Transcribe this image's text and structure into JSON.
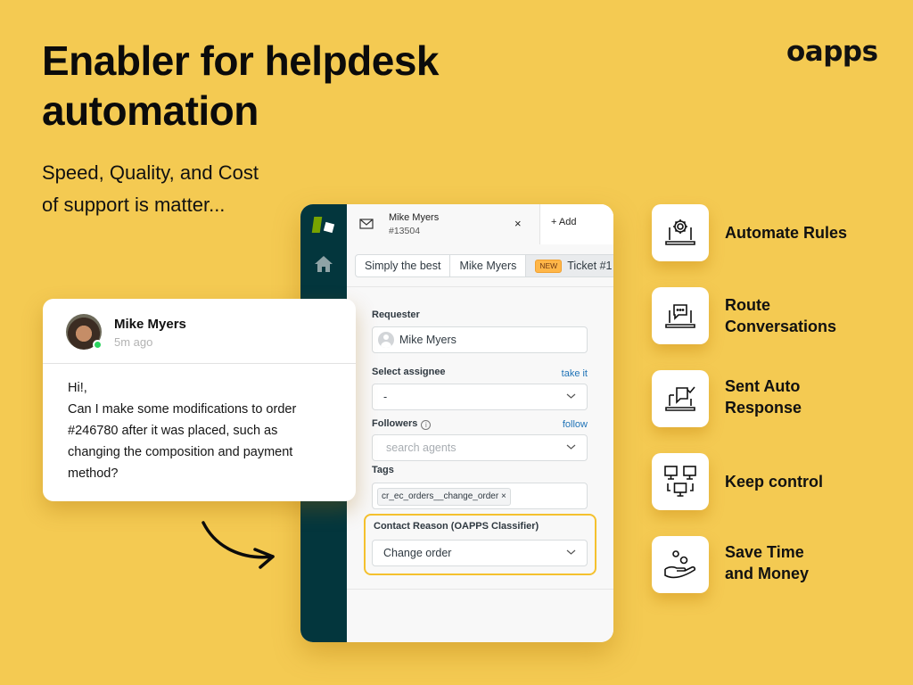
{
  "hero": {
    "headline_line1": "Enabler for helpdesk",
    "headline_line2": "automation",
    "subline_line1": "Speed, Quality, and Cost",
    "subline_line2": "of support is matter...",
    "brand": "oapps"
  },
  "chat": {
    "sender": "Mike Myers",
    "time": "5m ago",
    "status": "online",
    "lines": [
      "Hi!,",
      "Can I make some modifications to order",
      "#246780 after it was placed, such as",
      "changing the composition and payment",
      "method?"
    ]
  },
  "helpdesk": {
    "tab": {
      "title": "Mike Myers",
      "ticket_id": "#13504",
      "close": "×"
    },
    "add_tab": "+ Add",
    "breadcrumbs": [
      {
        "label": "Simply the best"
      },
      {
        "label": "Mike Myers"
      },
      {
        "badge": "NEW",
        "label": "Ticket #1"
      }
    ],
    "requester": {
      "label": "Requester",
      "value": "Mike Myers"
    },
    "assignee": {
      "label": "Select assignee",
      "link": "take it",
      "value": "-"
    },
    "followers": {
      "label": "Followers",
      "info": "i",
      "link": "follow",
      "placeholder": "search agents"
    },
    "tags": {
      "label": "Tags",
      "items": [
        "cr_ec_orders__change_order"
      ],
      "remove": "×"
    },
    "classifier": {
      "label": "Contact Reason (OAPPS Classifier)",
      "value": "Change order",
      "highlight": "#f4c12e"
    }
  },
  "features": [
    {
      "icon": "gear-laptop-icon",
      "label_line1": "Automate Rules",
      "label_line2": ""
    },
    {
      "icon": "chat-laptop-icon",
      "label_line1": "Route",
      "label_line2": "Conversations"
    },
    {
      "icon": "check-chat-laptop-icon",
      "label_line1": "Sent Auto",
      "label_line2": "Response"
    },
    {
      "icon": "network-monitors-icon",
      "label_line1": "Keep control",
      "label_line2": ""
    },
    {
      "icon": "hand-coins-icon",
      "label_line1": "Save Time",
      "label_line2": "and Money"
    }
  ],
  "colors": {
    "background": "#f4ca52",
    "rail": "#03363d",
    "link": "#1f73b7",
    "badge": "#ffb648",
    "online": "#2bd45f"
  }
}
